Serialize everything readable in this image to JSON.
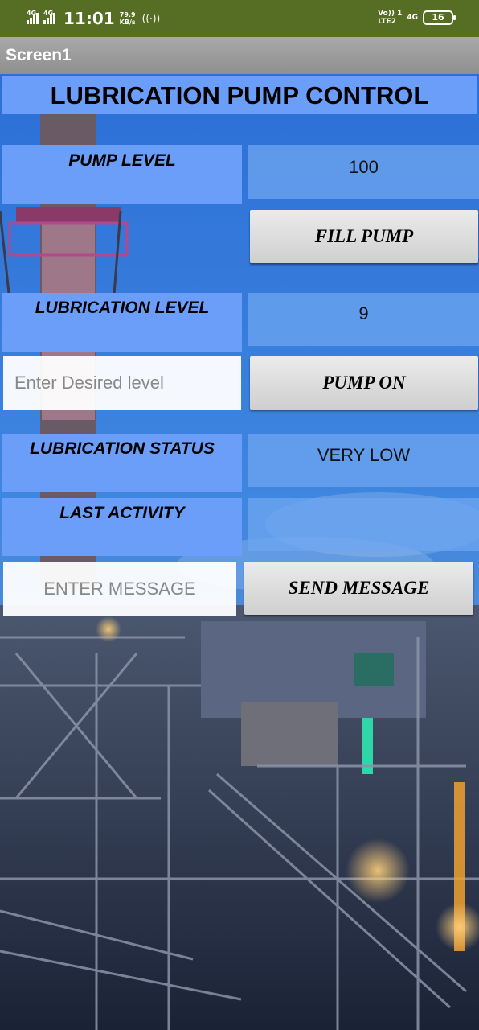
{
  "status_bar": {
    "sim1": "4G",
    "sim2": "4G",
    "time": "11:01",
    "speed_value": "79.9",
    "speed_unit": "KB/s",
    "volte": "Vo)) 1",
    "lte": "LTE2",
    "network": "4G",
    "battery": "16"
  },
  "app_bar": {
    "title": "Screen1"
  },
  "heading": "LUBRICATION PUMP CONTROL",
  "pump_level": {
    "label": "PUMP LEVEL",
    "value": "100"
  },
  "fill_pump_button": "FILL PUMP",
  "lubrication_level": {
    "label": "LUBRICATION LEVEL",
    "value": "9"
  },
  "desired_level_input": {
    "placeholder": "Enter Desired level",
    "value": ""
  },
  "pump_on_button": "PUMP ON",
  "lubrication_status": {
    "label": "LUBRICATION STATUS",
    "value": "VERY LOW"
  },
  "last_activity": {
    "label": "LAST ACTIVITY",
    "value": ""
  },
  "message_input": {
    "placeholder": "ENTER MESSAGE",
    "value": ""
  },
  "send_message_button": "SEND MESSAGE"
}
